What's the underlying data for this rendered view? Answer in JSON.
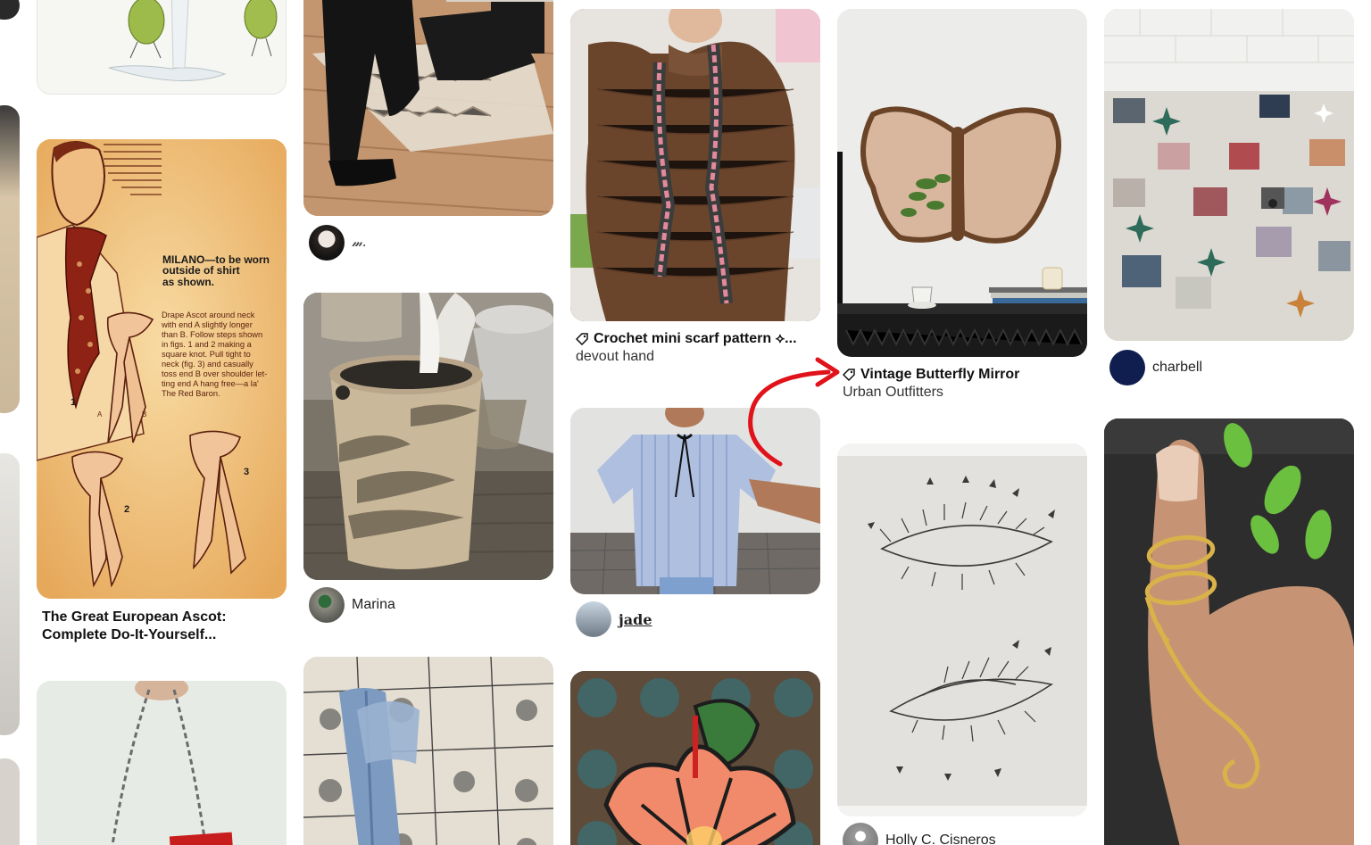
{
  "columns": {
    "c1": {
      "pin1": {},
      "pin2": {
        "title_line1": "The Great European Ascot:",
        "title_line2": "Complete Do-It-Yourself..."
      },
      "pin2_illustration": {
        "heading_line1": "MILANO—to be worn",
        "heading_line2": "outside of shirt",
        "heading_line3": "as shown.",
        "instructions": [
          "Drape Ascot around neck",
          "with end A slightly longer",
          "than B. Follow steps shown",
          "in figs. 1 and 2 making a",
          "square knot. Pull tight to",
          "neck (fig. 3) and casually",
          "toss end B over shoulder let-",
          "ting end A hang free—a la'",
          "The Red Baron."
        ],
        "fig1": "1",
        "fig2": "2",
        "fig3": "3",
        "end_a": "A",
        "end_b": "B"
      }
    },
    "c2": {
      "pin1": {
        "username": "𝓂."
      },
      "pin2": {
        "username": "Marina"
      }
    },
    "c3": {
      "pin1": {
        "title": "Crochet mini scarf pattern ⟡...",
        "subtitle": "devout hand"
      },
      "pin2": {
        "username": "jade"
      }
    },
    "c4": {
      "pin1": {
        "title": "Vintage Butterfly Mirror",
        "subtitle": "Urban Outfitters"
      },
      "pin2": {
        "username": "Holly C. Cisneros"
      }
    },
    "c5": {
      "pin1": {
        "username": "charbell"
      }
    }
  },
  "colors": {
    "annotation_arrow": "#e0121a",
    "avatar_charbell": "#0f1e4f"
  },
  "icons": [
    "tag-icon",
    "curved-arrow-icon"
  ]
}
